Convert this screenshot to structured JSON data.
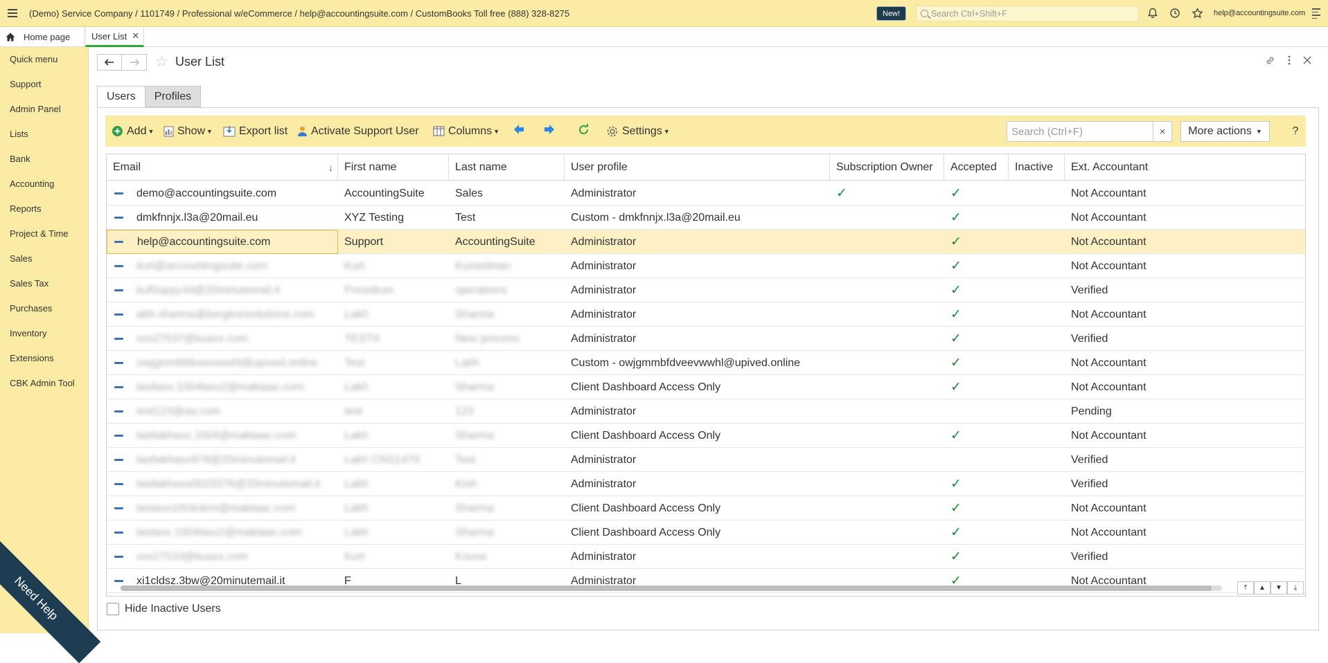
{
  "topbar": {
    "title": "(Demo) Service Company / 1101749 / Professional w/eCommerce / help@accountingsuite.com / CustomBooks Toll free (888) 328-8275",
    "new_badge": "New!",
    "search_placeholder": "Search Ctrl+Shift+F",
    "user": "help@accountingsuite.com"
  },
  "tabs": {
    "home": "Home page",
    "active": "User List"
  },
  "sidebar": {
    "items": [
      "Quick menu",
      "Support",
      "Admin Panel",
      "Lists",
      "Bank",
      "Accounting",
      "Reports",
      "Project & Time",
      "Sales",
      "Sales Tax",
      "Purchases",
      "Inventory",
      "Extensions",
      "CBK Admin Tool"
    ]
  },
  "need_help": "Need Help",
  "page": {
    "title": "User List",
    "subtabs": [
      "Users",
      "Profiles"
    ]
  },
  "toolbar": {
    "add": "Add",
    "show": "Show",
    "export": "Export list",
    "activate": "Activate Support User",
    "columns": "Columns",
    "settings": "Settings",
    "search_placeholder": "Search (Ctrl+F)",
    "search_clear": "×",
    "more_actions": "More actions",
    "help": "?"
  },
  "table": {
    "columns": [
      "Email",
      "First name",
      "Last name",
      "User profile",
      "Subscription Owner",
      "Accepted",
      "Inactive",
      "Ext. Accountant"
    ],
    "rows": [
      {
        "email": "demo@accountingsuite.com",
        "first": "AccountingSuite",
        "last": "Sales",
        "profile": "Administrator",
        "owner": "✓",
        "accepted": "✓",
        "inactive": "",
        "ext": "Not Accountant"
      },
      {
        "email": "dmkfnnjx.l3a@20mail.eu",
        "first": "XYZ Testing",
        "last": "Test",
        "profile": "Custom - dmkfnnjx.l3a@20mail.eu",
        "owner": "",
        "accepted": "✓",
        "inactive": "",
        "ext": "Not Accountant"
      },
      {
        "email": "help@accountingsuite.com",
        "first": "Support",
        "last": "AccountingSuite",
        "profile": "Administrator",
        "owner": "",
        "accepted": "✓",
        "inactive": "",
        "ext": "Not Accountant"
      },
      {
        "email": "kurt@accountingsuite.com",
        "first": "Kurt",
        "last": "Kunselman",
        "profile": "Administrator",
        "owner": "",
        "accepted": "✓",
        "inactive": "",
        "ext": "Not Accountant"
      },
      {
        "email": "kuf0upyy.lnl@20minutemail.it",
        "first": "Presidium",
        "last": "operations",
        "profile": "Administrator",
        "owner": "",
        "accepted": "✓",
        "inactive": "",
        "ext": "Verified"
      },
      {
        "email": "abh.sharma@bergkonsolutions.com",
        "first": "Lakh",
        "last": "Sharma",
        "profile": "Administrator",
        "owner": "",
        "accepted": "✓",
        "inactive": "",
        "ext": "Not Accountant"
      },
      {
        "email": "xxx27537@kuaxx.com",
        "first": "TESTX",
        "last": "New process",
        "profile": "Administrator",
        "owner": "",
        "accepted": "✓",
        "inactive": "",
        "ext": "Verified"
      },
      {
        "email": "owjgmmbfdveevwwhl@upived.online",
        "first": "Test",
        "last": "Lakh",
        "profile": "Custom - owjgmmbfdveevwwhl@upived.online",
        "owner": "",
        "accepted": "✓",
        "inactive": "",
        "ext": "Not Accountant"
      },
      {
        "email": "lastlaxx.1004laxx2@maktaac.com",
        "first": "Lakh",
        "last": "Sharma",
        "profile": "Client Dashboard Access Only",
        "owner": "",
        "accepted": "✓",
        "inactive": "",
        "ext": "Not Accountant"
      },
      {
        "email": "test123@aa.com",
        "first": "test",
        "last": "123",
        "profile": "Administrator",
        "owner": "",
        "accepted": "",
        "inactive": "",
        "ext": "Pending"
      },
      {
        "email": "lastlakhaxx.1004@maktaac.com",
        "first": "Lakh",
        "last": "Sharma",
        "profile": "Client Dashboard Access Only",
        "owner": "",
        "accepted": "✓",
        "inactive": "",
        "ext": "Not Accountant"
      },
      {
        "email": "lastlakhaxx978@20minutemail.it",
        "first": "Lakh CNS1470",
        "last": "Test",
        "profile": "Administrator",
        "owner": "",
        "accepted": "",
        "inactive": "",
        "ext": "Verified"
      },
      {
        "email": "lastlakhaxx0023378@20minutemail.it",
        "first": "Lakh",
        "last": "Kish",
        "profile": "Administrator",
        "owner": "",
        "accepted": "✓",
        "inactive": "",
        "ext": "Verified"
      },
      {
        "email": "lastaxx1004ckmi@maktaac.com",
        "first": "Lakh",
        "last": "Sharma",
        "profile": "Client Dashboard Access Only",
        "owner": "",
        "accepted": "✓",
        "inactive": "",
        "ext": "Not Accountant"
      },
      {
        "email": "lastaxx.1004laxx2@maktaac.com",
        "first": "Lakh",
        "last": "Sharma",
        "profile": "Client Dashboard Access Only",
        "owner": "",
        "accepted": "✓",
        "inactive": "",
        "ext": "Not Accountant"
      },
      {
        "email": "xxx27533@kuaxx.com",
        "first": "Kurt",
        "last": "Kouva",
        "profile": "Administrator",
        "owner": "",
        "accepted": "✓",
        "inactive": "",
        "ext": "Verified"
      },
      {
        "email": "xi1cldsz.3bw@20minutemail.it",
        "first": "F",
        "last": "L",
        "profile": "Administrator",
        "owner": "",
        "accepted": "✓",
        "inactive": "",
        "ext": "Not Accountant"
      }
    ]
  },
  "footer": {
    "hide_inactive": "Hide Inactive Users"
  }
}
